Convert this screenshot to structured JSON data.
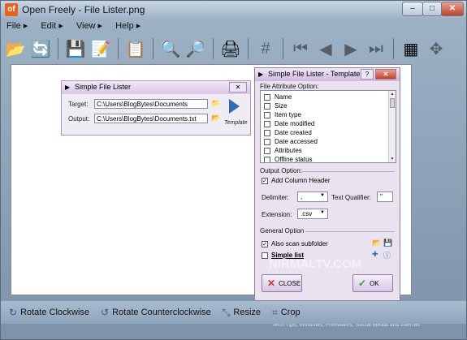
{
  "window": {
    "title": "Open Freely - File Lister.png",
    "app_icon_label": "of",
    "minimize_label": "–",
    "maximize_label": "□",
    "close_label": "✕"
  },
  "menu": [
    "File ▸",
    "Edit ▸",
    "View ▸",
    "Help ▸"
  ],
  "toolbar": [
    {
      "icon": "open-folder-icon",
      "glyph": "📂"
    },
    {
      "icon": "refresh-icon",
      "glyph": "🔄"
    },
    {
      "icon": "save-icon",
      "glyph": "💾"
    },
    {
      "icon": "save-as-icon",
      "glyph": "📝"
    },
    {
      "icon": "copy-icon",
      "glyph": "📋"
    },
    {
      "icon": "zoom-in-icon",
      "glyph": "🔍"
    },
    {
      "icon": "zoom-out-icon",
      "glyph": "🔎"
    },
    {
      "icon": "print-icon",
      "glyph": "🖨"
    },
    {
      "icon": "grid-icon",
      "glyph": "#"
    },
    {
      "icon": "first-icon",
      "glyph": "⏮"
    },
    {
      "icon": "prev-icon",
      "glyph": "◀"
    },
    {
      "icon": "next-icon",
      "glyph": "▶"
    },
    {
      "icon": "last-icon",
      "glyph": "⏭"
    },
    {
      "icon": "thumbnails-icon",
      "glyph": "▦"
    },
    {
      "icon": "move-icon",
      "glyph": "✥"
    }
  ],
  "lister": {
    "title": "Simple File Lister",
    "close_label": "✕",
    "target_label": "Target:",
    "target_value": "C:\\Users\\BlogBytes\\Documents",
    "output_label": "Output:",
    "output_value": "C:\\Users\\BlogBytes\\Documents.txt",
    "template_label": "Template"
  },
  "template": {
    "title": "Simple File Lister - Template",
    "help_label": "?",
    "close_label": "✕",
    "attr_section": "File Attribute Option:",
    "attributes": [
      "Name",
      "Size",
      "Item type",
      "Date modified",
      "Date created",
      "Date accessed",
      "Attributes",
      "Offline status"
    ],
    "output_section": "Output Option:",
    "add_column_header": "Add Column Header",
    "delimiter_label": "Delimiter:",
    "delimiter_value": ",",
    "qualifier_label": "Text Qualifier:",
    "qualifier_value": "\"",
    "extension_label": "Extension:",
    "extension_value": ".csv",
    "general_section": "General Option",
    "also_scan": "Also scan subfolder",
    "simple_list": "Simple list",
    "close_button": "CLOSE",
    "ok_button": "OK"
  },
  "statusbar": [
    {
      "icon": "rotate-cw-icon",
      "label": "Rotate Clockwise"
    },
    {
      "icon": "rotate-ccw-icon",
      "label": "Rotate Counterclockwise"
    },
    {
      "icon": "resize-icon",
      "label": "Resize"
    },
    {
      "icon": "crop-icon",
      "label": "Crop"
    }
  ],
  "watermark": {
    "brand": "NIRMALTV.COM",
    "tagline": "Tech Tips, Windows, Freewares, Social Media and Internet"
  },
  "colors": {
    "accent": "#2f6ab8",
    "close_red": "#c0402a",
    "dialog_bg": "#ebe2ef"
  }
}
